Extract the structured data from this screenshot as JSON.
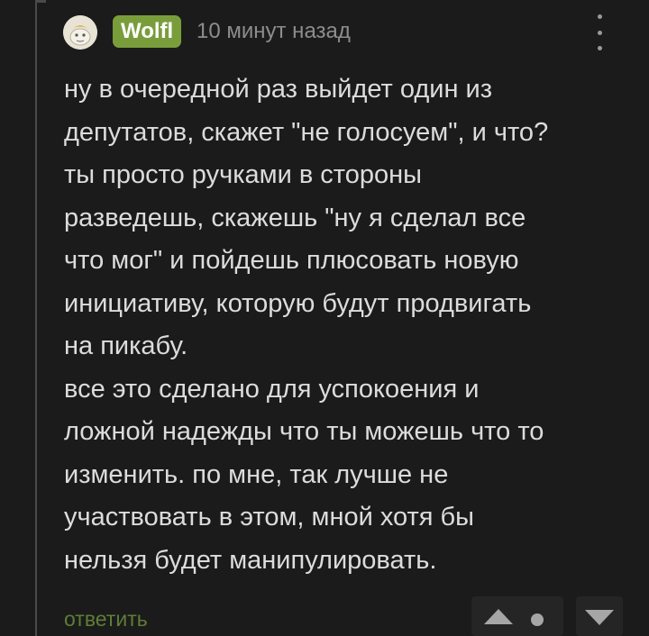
{
  "comment": {
    "author": "Wolfl",
    "timestamp": "10 минут назад",
    "body": "ну в очередной раз выйдет один из\nдепутатов, скажет \"не голосуем\", и что?\nты просто ручками в стороны\nразведешь, скажешь \"ну я сделал все\nчто мог\" и пойдешь плюсовать новую\nинициативу, которую будут продвигать\nна пикабу.\nвсе это сделано для успокоения и\nложной надежды что ты можешь что то\nизменить. по мне, так лучше не\nучаствовать в этом, мной хотя бы\nнельзя будет манипулировать.",
    "reply_label": "ответить"
  },
  "icons": {
    "avatar": "avatar-image",
    "more": "vertical-ellipsis-icon",
    "upvote": "triangle-up-icon",
    "vote_indicator": "dot-icon",
    "downvote": "triangle-down-icon"
  },
  "colors": {
    "background": "#1b1b1b",
    "username_badge": "#7a9d3c",
    "reply_link": "#5f7d36",
    "text": "#dcdcdc",
    "muted": "#8d8d8d"
  }
}
